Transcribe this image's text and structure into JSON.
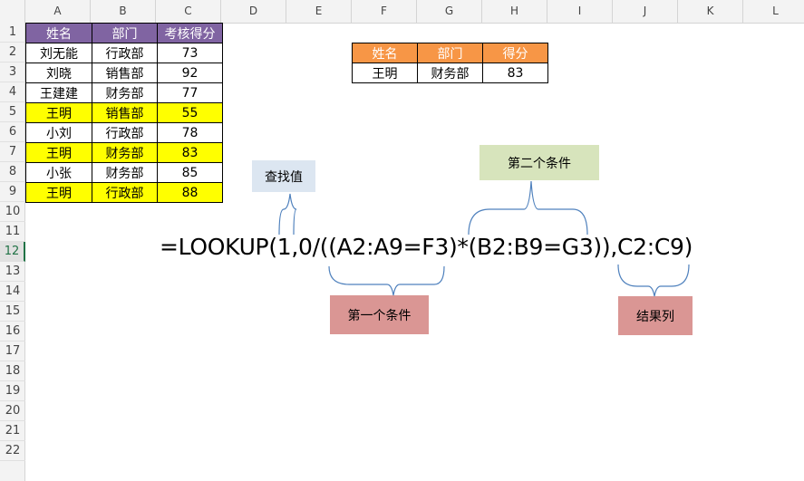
{
  "columns": [
    "A",
    "B",
    "C",
    "D",
    "E",
    "F",
    "G",
    "H",
    "I",
    "J",
    "K",
    "L"
  ],
  "rows": [
    "1",
    "2",
    "3",
    "4",
    "5",
    "6",
    "7",
    "8",
    "9",
    "10",
    "11",
    "12",
    "13",
    "14",
    "15",
    "16",
    "17",
    "18",
    "19",
    "20",
    "21",
    "22"
  ],
  "selected_row": "12",
  "main_table": {
    "headers": [
      "姓名",
      "部门",
      "考核得分"
    ],
    "rows": [
      {
        "name": "刘无能",
        "dept": "行政部",
        "score": "73",
        "highlight": false
      },
      {
        "name": "刘晓",
        "dept": "销售部",
        "score": "92",
        "highlight": false
      },
      {
        "name": "王建建",
        "dept": "财务部",
        "score": "77",
        "highlight": false
      },
      {
        "name": "王明",
        "dept": "销售部",
        "score": "55",
        "highlight": true
      },
      {
        "name": "小刘",
        "dept": "行政部",
        "score": "78",
        "highlight": false
      },
      {
        "name": "王明",
        "dept": "财务部",
        "score": "83",
        "highlight": true
      },
      {
        "name": "小张",
        "dept": "财务部",
        "score": "85",
        "highlight": false
      },
      {
        "name": "王明",
        "dept": "行政部",
        "score": "88",
        "highlight": true
      }
    ]
  },
  "lookup_table": {
    "headers": [
      "姓名",
      "部门",
      "得分"
    ],
    "values": [
      "王明",
      "财务部",
      "83"
    ]
  },
  "formula": "=LOOKUP(1,0/((A2:A9=F3)*(B2:B9=G3)),C2:C9)",
  "annotations": {
    "lookup_value": "查找值",
    "condition_2": "第二个条件",
    "condition_1": "第一个条件",
    "result_column": "结果列"
  },
  "colors": {
    "header_purple": "#8064a2",
    "header_orange": "#f79646",
    "highlight": "#ffff00",
    "note_blue": "#dce6f1",
    "note_green": "#d7e4bc",
    "note_red": "#da9694",
    "brace": "#4f81bd"
  }
}
